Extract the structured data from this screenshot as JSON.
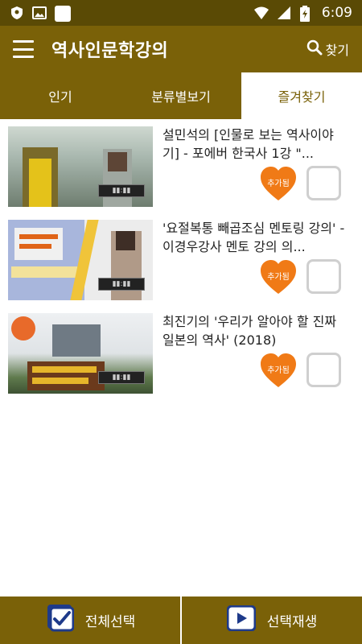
{
  "status_bar": {
    "time": "6:09"
  },
  "app_bar": {
    "title": "역사인문학강의",
    "search_label": "찾기"
  },
  "tabs": [
    {
      "label": "인기",
      "active": false
    },
    {
      "label": "분류별보기",
      "active": false
    },
    {
      "label": "즐겨찾기",
      "active": true
    }
  ],
  "videos": [
    {
      "title": "설민석의 [인물로 보는 역사이야기] - 포에버 한국사 1강 \"...",
      "favorite_label": "추가됨",
      "selected": false
    },
    {
      "title": "'요절복통 빼곱조심 멘토링 강의' - 이경우강사 멘토 강의 의...",
      "favorite_label": "추가됨",
      "selected": false
    },
    {
      "title": "최진기의 '우리가 알아야 할 진짜 일본의 역사' (2018)",
      "favorite_label": "추가됨",
      "selected": false
    }
  ],
  "bottom_bar": {
    "select_all_label": "전체선택",
    "play_selected_label": "선택재생"
  },
  "colors": {
    "primary": "#7a6108",
    "status_bar": "#5a4a05",
    "heart": "#f07a16",
    "checkbox_border": "#cfcfcf"
  }
}
